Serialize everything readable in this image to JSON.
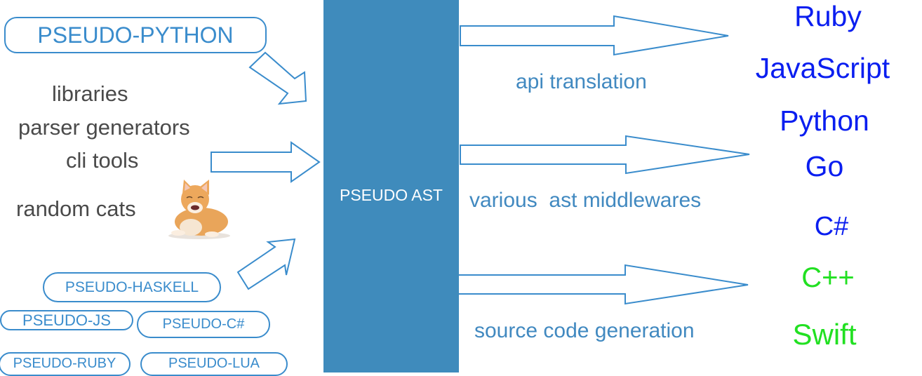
{
  "center": {
    "label": "PSEUDO AST",
    "color": "#3f8bbc"
  },
  "inputs": {
    "primary": "PSEUDO-PYTHON",
    "tools": [
      "libraries",
      "parser generators",
      "cli tools",
      "random cats"
    ],
    "others": [
      "PSEUDO-HASKELL",
      "PSEUDO-JS",
      "PSEUDO-C#",
      "PSEUDO-RUBY",
      "PSEUDO-LUA"
    ]
  },
  "stages": [
    "api translation",
    "various  ast middlewares",
    "source code generation"
  ],
  "targets": [
    {
      "name": "Ruby",
      "color": "#0a1ef0"
    },
    {
      "name": "JavaScript",
      "color": "#0a1ef0"
    },
    {
      "name": "Python",
      "color": "#0a1ef0"
    },
    {
      "name": "Go",
      "color": "#0a1ef0"
    },
    {
      "name": "C#",
      "color": "#0a1ef0"
    },
    {
      "name": "C++",
      "color": "#22e022"
    },
    {
      "name": "Swift",
      "color": "#22e022"
    }
  ],
  "colors": {
    "accent": "#3a8ccc",
    "gray_text": "#4a4a4a",
    "stage_text": "#4189c0"
  },
  "images": {
    "cat": "cat-illustration"
  }
}
